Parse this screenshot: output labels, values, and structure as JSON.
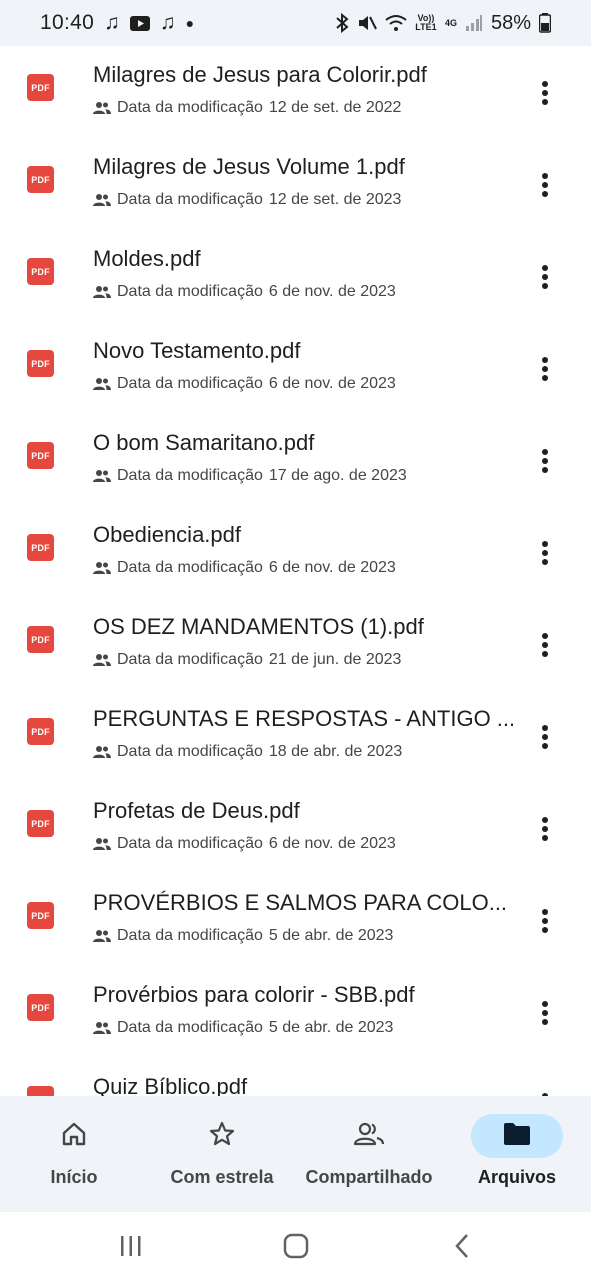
{
  "status_bar": {
    "time": "10:40",
    "network": "4G",
    "lte_label": "Vo)) LTE1",
    "battery": "58%"
  },
  "files": [
    {
      "name": "Milagres de Jesus para Colorir.pdf",
      "meta_label": "Data da modificação",
      "date": "12 de set. de 2022",
      "icon": "PDF"
    },
    {
      "name": "Milagres de Jesus Volume 1.pdf",
      "meta_label": "Data da modificação",
      "date": "12 de set. de 2023",
      "icon": "PDF"
    },
    {
      "name": "Moldes.pdf",
      "meta_label": "Data da modificação",
      "date": "6 de nov. de 2023",
      "icon": "PDF"
    },
    {
      "name": "Novo Testamento.pdf",
      "meta_label": "Data da modificação",
      "date": "6 de nov. de 2023",
      "icon": "PDF"
    },
    {
      "name": "O bom Samaritano.pdf",
      "meta_label": "Data da modificação",
      "date": "17 de ago. de 2023",
      "icon": "PDF"
    },
    {
      "name": "Obediencia.pdf",
      "meta_label": "Data da modificação",
      "date": "6 de nov. de 2023",
      "icon": "PDF"
    },
    {
      "name": "OS DEZ MANDAMENTOS (1).pdf",
      "meta_label": "Data da modificação",
      "date": "21 de jun. de 2023",
      "icon": "PDF"
    },
    {
      "name": "PERGUNTAS E RESPOSTAS - ANTIGO ...",
      "meta_label": "Data da modificação",
      "date": "18 de abr. de 2023",
      "icon": "PDF"
    },
    {
      "name": "Profetas de Deus.pdf",
      "meta_label": "Data da modificação",
      "date": "6 de nov. de 2023",
      "icon": "PDF"
    },
    {
      "name": "PROVÉRBIOS E SALMOS PARA COLO...",
      "meta_label": "Data da modificação",
      "date": "5 de abr. de 2023",
      "icon": "PDF"
    },
    {
      "name": "Provérbios para colorir - SBB.pdf",
      "meta_label": "Data da modificação",
      "date": "5 de abr. de 2023",
      "icon": "PDF"
    },
    {
      "name": "Quiz Bíblico.pdf",
      "meta_label": "",
      "date": "",
      "icon": "PDF"
    }
  ],
  "bottom_nav": {
    "items": [
      {
        "label": "Início",
        "icon": "home-icon"
      },
      {
        "label": "Com estrela",
        "icon": "star-icon"
      },
      {
        "label": "Compartilhado",
        "icon": "shared-icon"
      },
      {
        "label": "Arquivos",
        "icon": "folder-icon"
      }
    ],
    "active": "Arquivos"
  },
  "colors": {
    "accent_pill": "#c2e7ff",
    "pdf_red": "#e5483f",
    "surface": "#f0f4f9"
  }
}
